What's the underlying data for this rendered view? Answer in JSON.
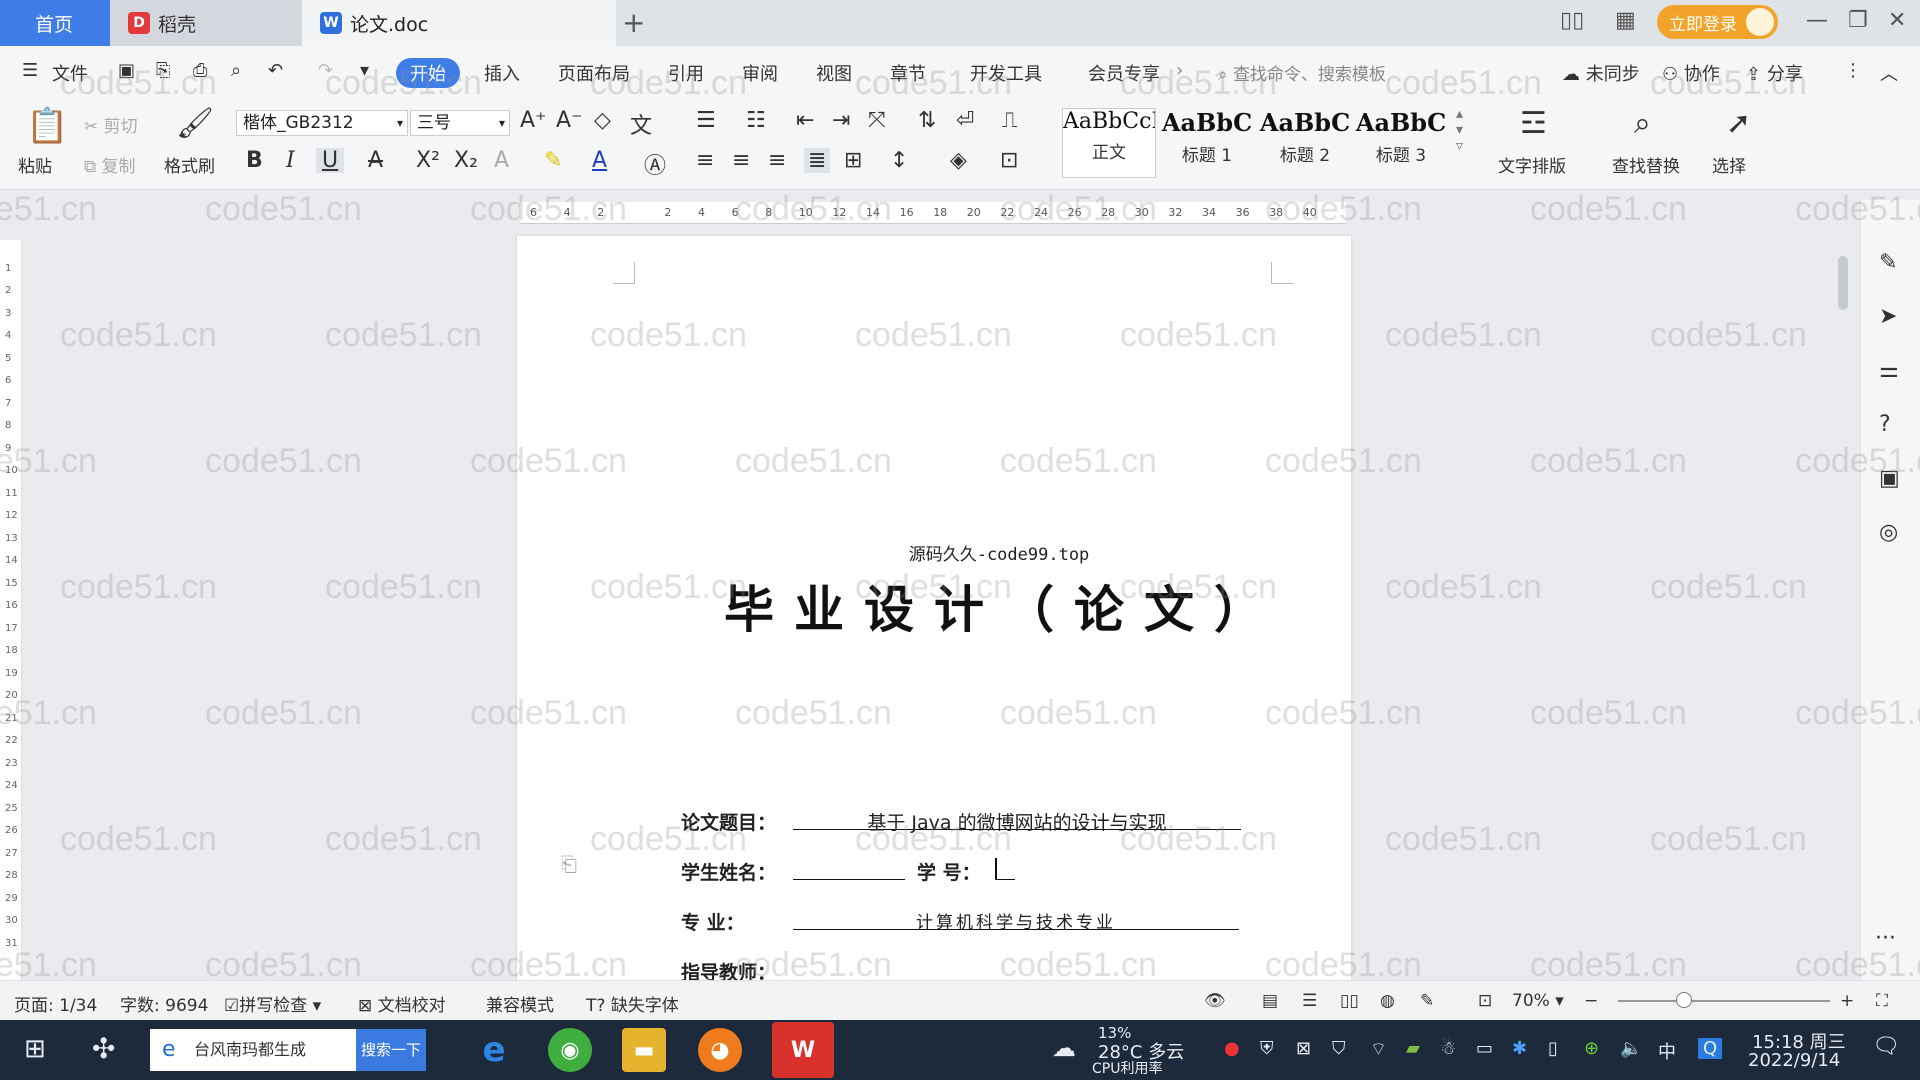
{
  "tabs": {
    "home": "首页",
    "daoke": "稻壳",
    "doc": "论文.doc",
    "add": "+"
  },
  "titlebar": {
    "login": "立即登录"
  },
  "menu": {
    "file": "文件",
    "items": [
      "开始",
      "插入",
      "页面布局",
      "引用",
      "审阅",
      "视图",
      "章节",
      "开发工具",
      "会员专享"
    ],
    "search_placeholder": "查找命令、搜索模板",
    "sync": "未同步",
    "collab": "协作",
    "share": "分享"
  },
  "ribbon": {
    "paste": "粘贴",
    "cut": "剪切",
    "copy": "复制",
    "format_painter": "格式刷",
    "font_name": "楷体_GB2312",
    "font_size": "三号",
    "styles": [
      {
        "sample": "AaBbCcI",
        "name": "正文"
      },
      {
        "sample": "AaBbC",
        "name": "标题 1"
      },
      {
        "sample": "AaBbC",
        "name": "标题 2"
      },
      {
        "sample": "AaBbC",
        "name": "标题 3"
      }
    ],
    "text_layout": "文字排版",
    "find_replace": "查找替换",
    "select": "选择"
  },
  "document": {
    "source_line": "源码久久-code99.top",
    "title": "毕业设计（论文）",
    "fields": [
      {
        "label": "论文题目：",
        "value": "基于 Java 的微博网站的设计与实现"
      },
      {
        "label": "学生姓名：",
        "value": ""
      },
      {
        "label": "学  号：",
        "value": ""
      },
      {
        "label": "专    业：",
        "value": "计算机科学与技术专业"
      },
      {
        "label": "指导教师：",
        "value": ""
      }
    ]
  },
  "statusbar": {
    "page": "页面: 1/34",
    "words": "字数: 9694",
    "spell": "拼写检查",
    "proof": "文档校对",
    "compat": "兼容模式",
    "missing_font": "缺失字体",
    "zoom": "70%"
  },
  "taskbar": {
    "search_text": "台风南玛都生成",
    "search_btn": "搜索一下",
    "weather": "28°C 多云",
    "cpu": "13%",
    "cpu_label": "CPU利用率",
    "ime": "中",
    "time": "15:18 周三",
    "date": "2022/9/14"
  },
  "watermark": "code51.cn",
  "colors": {
    "accent": "#3f7ee8",
    "login": "#f1a32a",
    "taskbar": "#1d2a3c"
  }
}
